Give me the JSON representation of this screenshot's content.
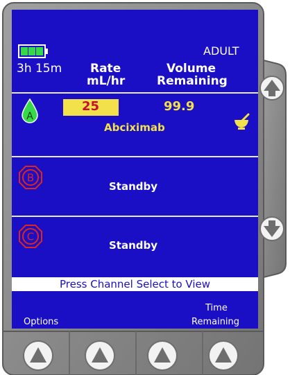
{
  "header": {
    "mode": "ADULT",
    "battery_time": "3h 15m",
    "battery_level": 1.0,
    "rate_col_line1": "Rate",
    "rate_col_line2": "mL/hr",
    "volume_col_line1": "Volume",
    "volume_col_line2": "Remaining"
  },
  "channels": [
    {
      "id": "A",
      "rate": "25",
      "volume": "99.9",
      "drug": "Abciximab",
      "icon": "drop-icon"
    },
    {
      "id": "B",
      "status": "Standby",
      "icon": "stop-octagon-icon"
    },
    {
      "id": "C",
      "status": "Standby",
      "icon": "stop-octagon-icon"
    }
  ],
  "banner": "Press Channel Select to View",
  "softkeys": {
    "options": "Options",
    "time_line1": "Time",
    "time_line2": "Remaining"
  },
  "colors": {
    "screen": "#1a0fc4",
    "channel_a_drop": "#36d94a",
    "standby_octagon": "#e0251c",
    "rate_box": "#f2e14a",
    "rate_text": "#c8102e",
    "volume_text": "#f2e14a",
    "bezel": "#8a8a8a"
  },
  "icons": [
    "battery-icon",
    "drop-icon",
    "mortar-pestle-icon",
    "stop-octagon-icon",
    "up-arrow-icon",
    "down-arrow-icon",
    "softkey-triangle-icon"
  ]
}
